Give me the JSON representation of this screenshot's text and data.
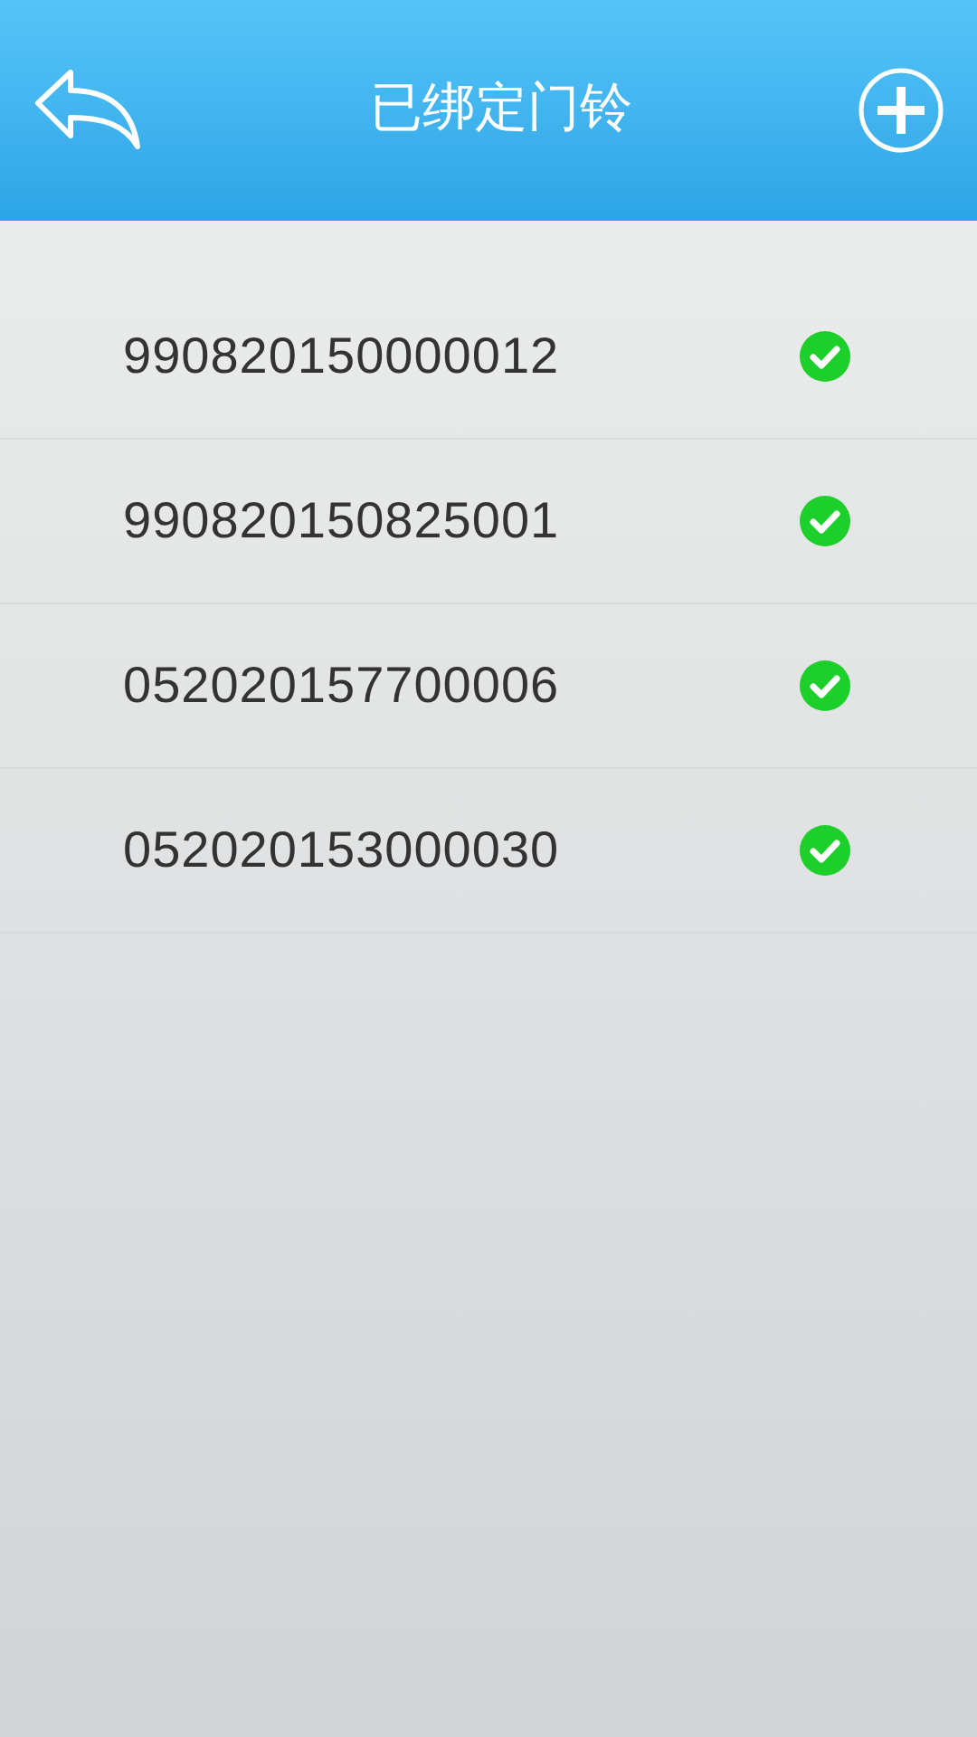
{
  "header": {
    "title": "已绑定门铃"
  },
  "doorbells": [
    {
      "id_text": "990820150000012",
      "checked": true
    },
    {
      "id_text": "990820150825001",
      "checked": true
    },
    {
      "id_text": "052020157700006",
      "checked": true
    },
    {
      "id_text": "052020153000030",
      "checked": true
    }
  ]
}
